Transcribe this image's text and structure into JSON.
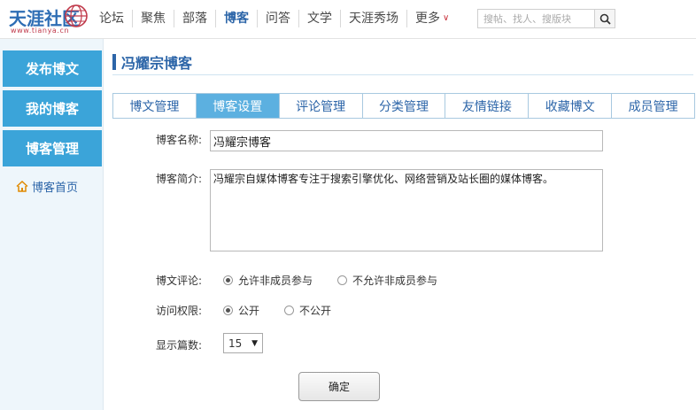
{
  "header": {
    "logo_text": "天涯社区",
    "logo_sub": "www.tianya.cn",
    "nav": [
      "论坛",
      "聚焦",
      "部落",
      "博客",
      "问答",
      "文学",
      "天涯秀场"
    ],
    "nav_active_index": 3,
    "more_label": "更多",
    "search_placeholder": "搜帖、找人、搜版块",
    "search_icon": "search-icon"
  },
  "sidebar": {
    "buttons": [
      "发布博文",
      "我的博客",
      "博客管理"
    ],
    "home_link": "博客首页",
    "home_icon": "home-icon"
  },
  "main": {
    "title": "冯耀宗博客",
    "tabs": [
      "博文管理",
      "博客设置",
      "评论管理",
      "分类管理",
      "友情链接",
      "收藏博文",
      "成员管理"
    ],
    "active_tab_index": 1,
    "form": {
      "name_label": "博客名称:",
      "name_value": "冯耀宗博客",
      "intro_label": "博客简介:",
      "intro_value": "冯耀宗自媒体博客专注于搜索引擎优化、网络营销及站长圈的媒体博客。",
      "comment_label": "博文评论:",
      "comment_options": [
        "允许非成员参与",
        "不允许非成员参与"
      ],
      "comment_selected": 0,
      "access_label": "访问权限:",
      "access_options": [
        "公开",
        "不公开"
      ],
      "access_selected": 0,
      "count_label": "显示篇数:",
      "count_value": "15",
      "submit_label": "确定"
    }
  },
  "colors": {
    "brand_blue": "#2c65a8",
    "sidebar_button": "#3ba4d9",
    "active_tab": "#5cb0e0",
    "sidebar_bg": "#eef6fb"
  }
}
